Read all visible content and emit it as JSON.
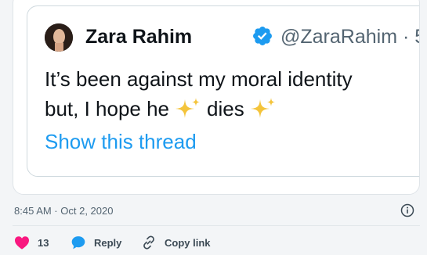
{
  "quoted_tweet": {
    "author_name": "Zara Rahim",
    "author_handle": "@ZaraRahim · 5",
    "text_line_1": "It’s been against my moral identity",
    "text_line_2_a": "but, I hope he",
    "text_line_2_b": "dies",
    "show_thread_label": "Show this thread"
  },
  "tweet_meta": {
    "timestamp": "8:45 AM · Oct 2, 2020"
  },
  "actions": {
    "like_count": "13",
    "reply_label": "Reply",
    "copy_link_label": "Copy link"
  },
  "colors": {
    "accent": "#1d9bf0",
    "like": "#f91880",
    "sparkle": "#f4c43b"
  },
  "icons": [
    "verified-badge-icon",
    "sparkles-icon",
    "info-icon",
    "heart-icon",
    "reply-bubble-icon",
    "link-icon"
  ]
}
